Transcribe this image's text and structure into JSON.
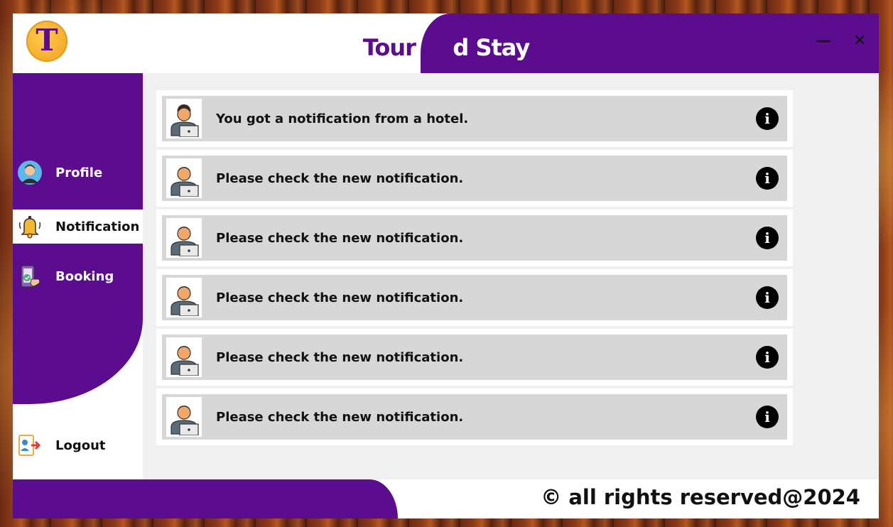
{
  "app": {
    "title_part1": "Tour an",
    "title_part2": "d Stay",
    "logo_letter": "T",
    "minimize_glyph": "—",
    "close_glyph": "✕"
  },
  "sidebar": {
    "items": [
      {
        "label": "Profile",
        "icon": "profile-avatar-icon"
      },
      {
        "label": "Notification",
        "icon": "bell-icon",
        "active": true
      },
      {
        "label": "Booking",
        "icon": "booking-phone-icon"
      }
    ],
    "logout_label": "Logout"
  },
  "notifications": [
    {
      "message": "You got a notification from a hotel."
    },
    {
      "message": "Please check the new notification."
    },
    {
      "message": "Please check the new notification."
    },
    {
      "message": "Please check the new notification."
    },
    {
      "message": "Please check the new notification."
    },
    {
      "message": "Please check the new notification."
    }
  ],
  "footer": {
    "copyright": "© all rights reserved@2024"
  },
  "colors": {
    "brand_purple": "#5b0c8f",
    "logo_gold": "#f0a020",
    "card_gray": "#d7d7d7"
  }
}
